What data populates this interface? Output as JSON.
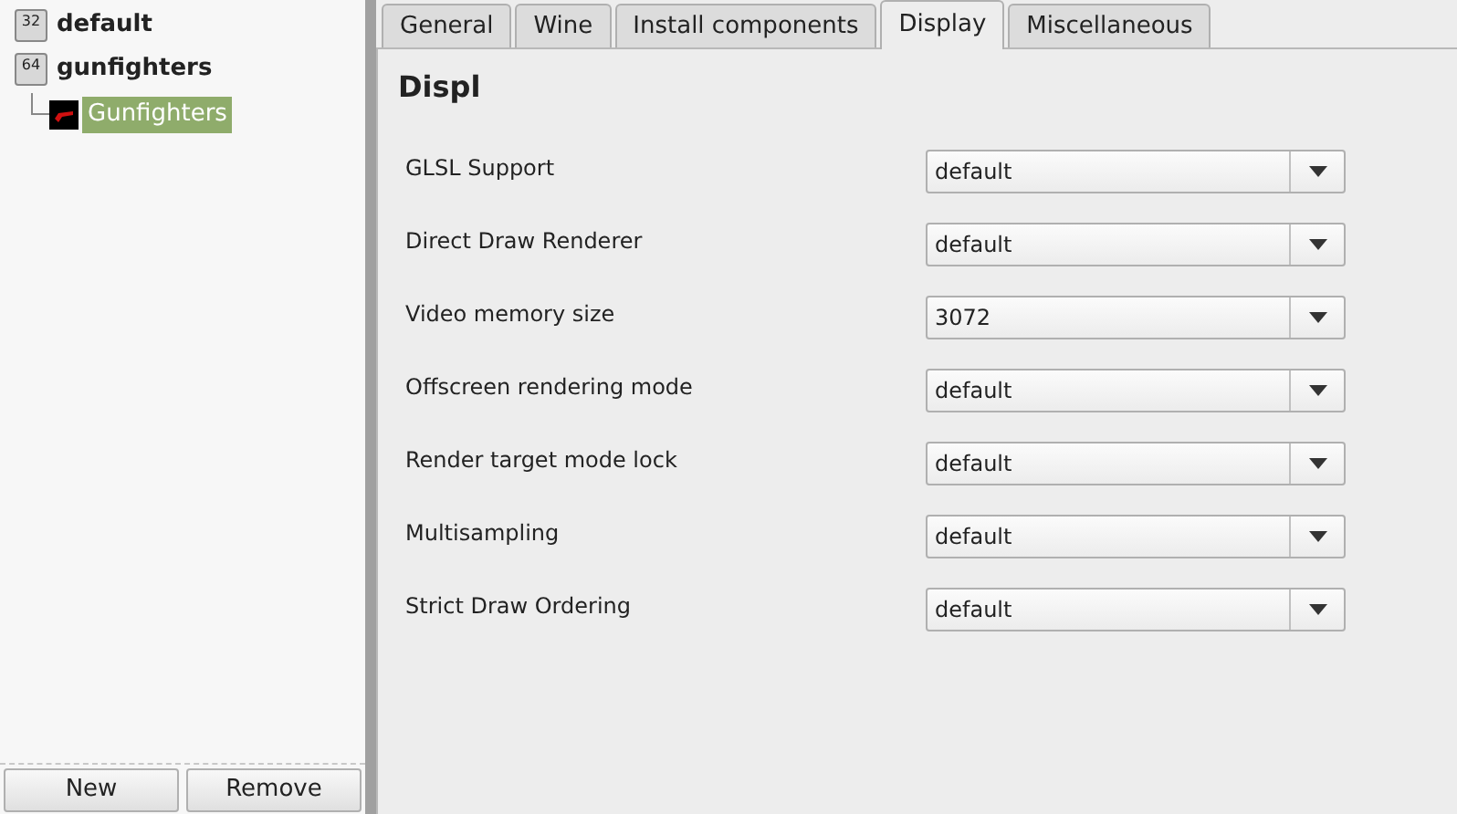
{
  "tree": [
    {
      "label": "default",
      "badge": "32",
      "selected": false
    },
    {
      "label": "gunfighters",
      "badge": "64",
      "selected": false,
      "children": [
        {
          "label": "Gunfighters",
          "selected": true
        }
      ]
    }
  ],
  "buttons": [
    "New",
    "Remove"
  ],
  "tabs": [
    {
      "label": "General",
      "selected": false
    },
    {
      "label": "Wine",
      "selected": false
    },
    {
      "label": "Install components",
      "selected": false
    },
    {
      "label": "Display",
      "selected": true
    },
    {
      "label": "Miscellaneous",
      "selected": false
    }
  ],
  "heading": "Displ",
  "settings": [
    {
      "label": "GLSL Support",
      "value": "default"
    },
    {
      "label": "Direct Draw Renderer",
      "value": "default"
    },
    {
      "label": "Video memory size",
      "value": "3072"
    },
    {
      "label": "Offscreen rendering mode",
      "value": "default"
    },
    {
      "label": "Render target mode lock",
      "value": "default"
    },
    {
      "label": "Multisampling",
      "value": "default"
    },
    {
      "label": "Strict Draw Ordering",
      "value": "default"
    }
  ]
}
